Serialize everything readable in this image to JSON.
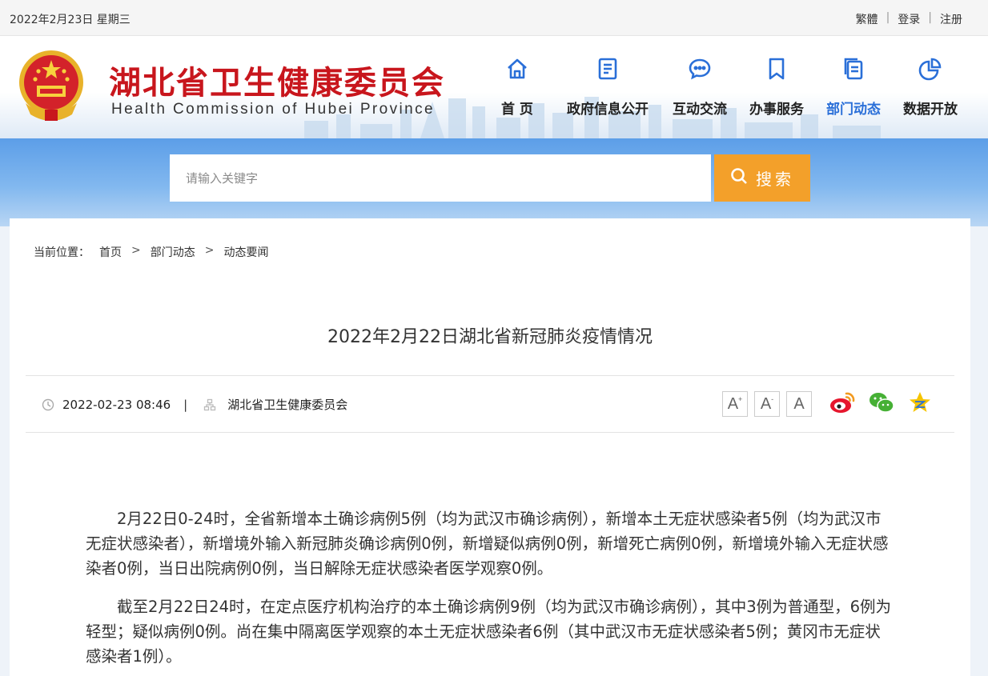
{
  "topbar": {
    "date": "2022年2月23日 星期三",
    "traditional": "繁體",
    "login": "登录",
    "register": "注册",
    "sep": "|"
  },
  "header": {
    "title": "湖北省卫生健康委员会",
    "subtitle": "Health Commission of Hubei Province"
  },
  "nav": [
    {
      "label": "首 页",
      "icon": "home-icon"
    },
    {
      "label": "政府信息公开",
      "icon": "document-icon"
    },
    {
      "label": "互动交流",
      "icon": "chat-icon"
    },
    {
      "label": "办事服务",
      "icon": "bookmark-icon"
    },
    {
      "label": "部门动态",
      "icon": "pages-icon",
      "active": true
    },
    {
      "label": "数据开放",
      "icon": "pie-chart-icon"
    }
  ],
  "search": {
    "placeholder": "请输入关键字",
    "button": "搜索"
  },
  "breadcrumb": {
    "prefix": "当前位置：",
    "items": [
      "首页",
      "部门动态",
      "动态要闻"
    ],
    "separator": ">"
  },
  "article": {
    "title": "2022年2月22日湖北省新冠肺炎疫情情况",
    "datetime": "2022-02-23 08:46",
    "meta_sep": "|",
    "source": "湖北省卫生健康委员会",
    "paragraphs": [
      "2月22日0-24时，全省新增本土确诊病例5例（均为武汉市确诊病例），新增本土无症状感染者5例（均为武汉市无症状感染者），新增境外输入新冠肺炎确诊病例0例，新增疑似病例0例，新增死亡病例0例，新增境外输入无症状感染者0例，当日出院病例0例，当日解除无症状感染者医学观察0例。",
      "截至2月22日24时，在定点医疗机构治疗的本土确诊病例9例（均为武汉市确诊病例），其中3例为普通型，6例为轻型；疑似病例0例。尚在集中隔离医学观察的本土无症状感染者6例（其中武汉市无症状感染者5例；黄冈市无症状感染者1例）。"
    ]
  },
  "font_controls": {
    "increase": "A",
    "decrease": "A",
    "reset": "A",
    "plus": "+",
    "minus": "-"
  },
  "colors": {
    "brand_red": "#c8161d",
    "accent_blue": "#2a6fd8",
    "search_orange": "#f3a02a"
  }
}
